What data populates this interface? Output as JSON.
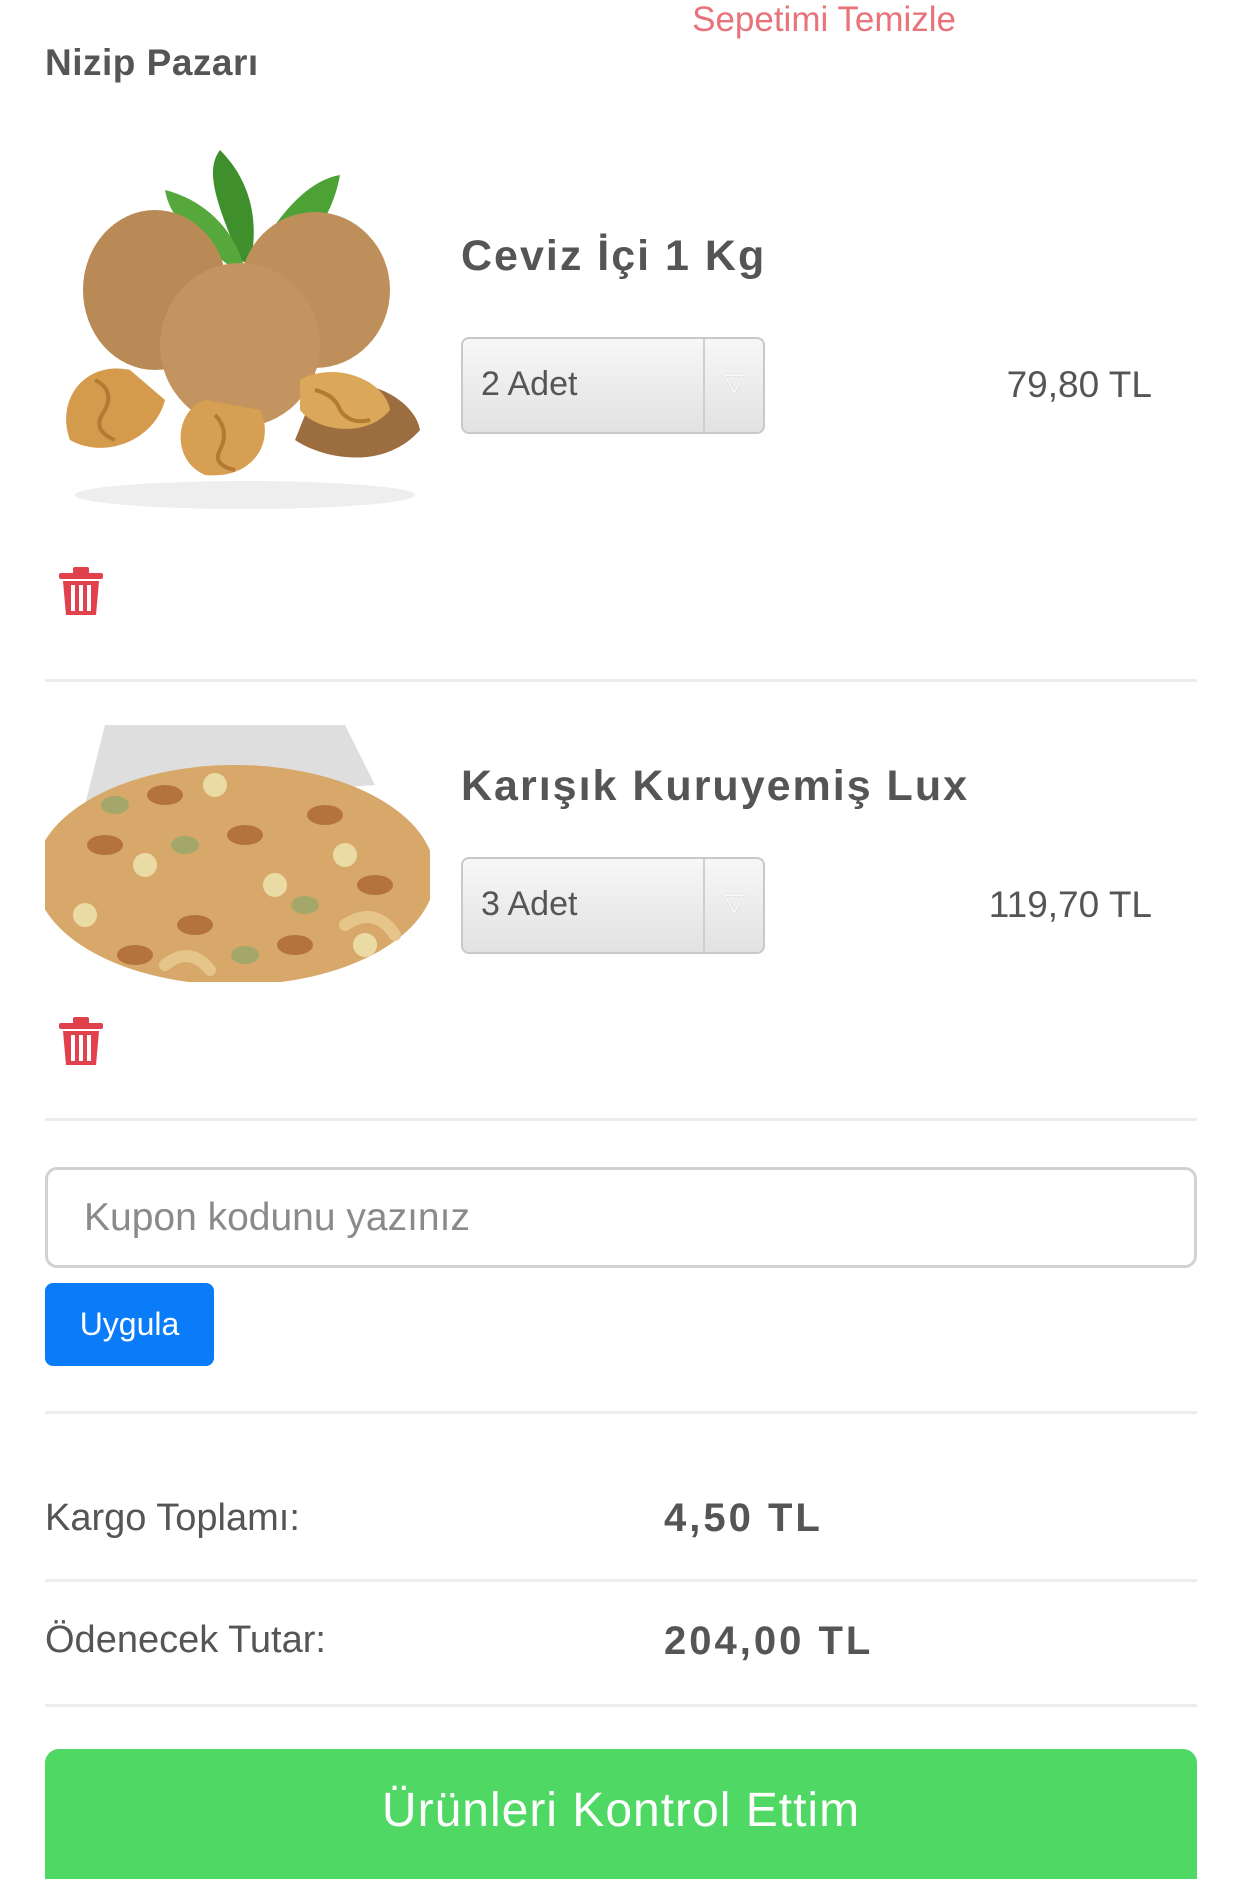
{
  "header": {
    "shop_name": "Nizip Pazarı",
    "clear_cart_label": "Sepetimi Temizle"
  },
  "cart": {
    "items": [
      {
        "title": "Ceviz İçi 1 Kg",
        "quantity": "2 Adet",
        "price": "79,80 TL"
      },
      {
        "title": "Karışık Kuruyemiş Lux",
        "quantity": "3 Adet",
        "price": "119,70 TL"
      }
    ]
  },
  "coupon": {
    "placeholder": "Kupon kodunu yazınız",
    "apply_label": "Uygula"
  },
  "summary": {
    "shipping_label": "Kargo Toplamı:",
    "shipping_value": "4,50 TL",
    "total_label": "Ödenecek Tutar:",
    "total_value": "204,00 TL"
  },
  "checkout": {
    "label": "Ürünleri Kontrol Ettim"
  },
  "colors": {
    "accent_red": "#e8737a",
    "apply_blue": "#0a7cf9",
    "checkout_green": "#4fd863",
    "trash_red": "#e0414d"
  }
}
